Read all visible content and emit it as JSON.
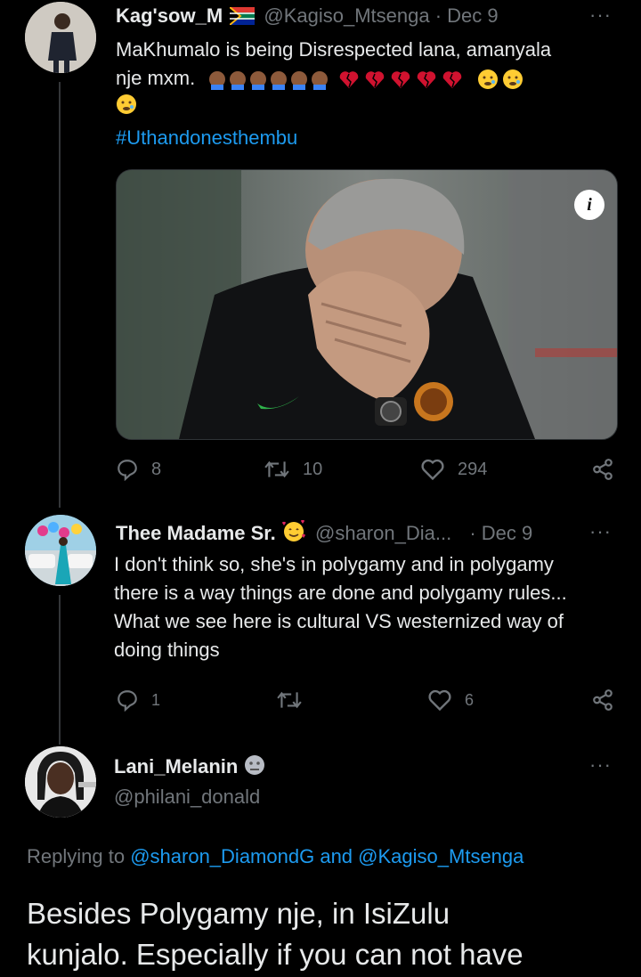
{
  "tweet1": {
    "display_name": "Kag'sow_M",
    "handle": "@Kagiso_Mtsenga",
    "date": "· Dec 9",
    "text_line1": "MaKhumalo is being Disrespected lana, amanyala",
    "text_line2": "nje mxm.",
    "hashtag": "#Uthandonesthembu",
    "media_info_label": "i",
    "reply_count": "8",
    "retweet_count": "10",
    "like_count": "294",
    "more": "···"
  },
  "tweet2": {
    "display_name": "Thee Madame Sr.",
    "handle": "@sharon_Dia...",
    "date": "· Dec 9",
    "text_lines": [
      "I don't think so, she's in polygamy and in polygamy",
      "there is a way things are done and polygamy rules...",
      "What we see here is cultural VS westernized way of",
      "doing things"
    ],
    "reply_count": "1",
    "like_count": "6",
    "more": "···"
  },
  "tweet3": {
    "display_name": "Lani_Melanin",
    "handle": "@philani_donald",
    "replying_prefix": "Replying to",
    "replying_user1": "@sharon_DiamondG",
    "replying_and": "and",
    "replying_user2": "@Kagiso_Mtsenga",
    "text_line1": "Besides Polygamy nje, in IsiZulu",
    "text_line2": "kunjalo. Especially if you can not have",
    "more": "···"
  },
  "colors": {
    "accent": "#1d9bf0",
    "muted": "#71767b",
    "background": "#000000",
    "heart_red": "#d0122f"
  },
  "icons": [
    "reply-icon",
    "retweet-icon",
    "like-icon",
    "share-icon",
    "info-icon",
    "more-icon"
  ]
}
